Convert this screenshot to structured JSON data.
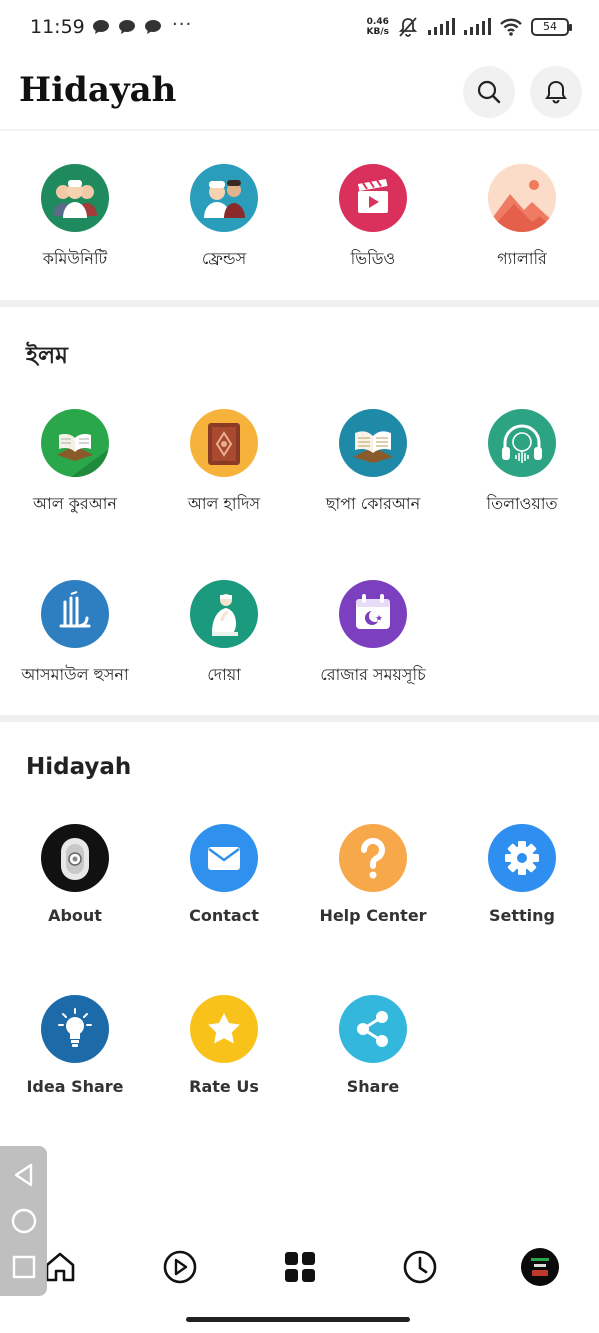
{
  "status_bar": {
    "time": "11:59",
    "dots": "···",
    "speed_value": "0.46",
    "speed_unit": "KB/s",
    "battery": "54"
  },
  "header": {
    "title": "Hidayah",
    "search_icon": "search-icon",
    "bell_icon": "bell-icon"
  },
  "top_grid": [
    {
      "label": "কমিউনিটি",
      "icon": "community-icon",
      "color": "#1f8a5e"
    },
    {
      "label": "ফ্রেন্ডস",
      "icon": "friends-icon",
      "color": "#2a9dbb"
    },
    {
      "label": "ভিডিও",
      "icon": "video-icon",
      "color": "#d9305c"
    },
    {
      "label": "গ্যালারি",
      "icon": "gallery-icon",
      "color": "#f5a388"
    }
  ],
  "ilm": {
    "title": "ইলম",
    "items": [
      {
        "label": "আল কুরআন",
        "icon": "quran-icon",
        "color": "#2aa74a"
      },
      {
        "label": "আল হাদিস",
        "icon": "hadith-icon",
        "color": "#f6b33c"
      },
      {
        "label": "ছাপা কোরআন",
        "icon": "printed-quran-icon",
        "color": "#1f8aa8"
      },
      {
        "label": "তিলাওয়াত",
        "icon": "tilawat-icon",
        "color": "#2ca382"
      },
      {
        "label": "আসমাউল হুসনা",
        "icon": "allah-icon",
        "color": "#2e7fc1"
      },
      {
        "label": "দোয়া",
        "icon": "dua-icon",
        "color": "#1b9a7d"
      },
      {
        "label": "রোজার সময়সূচি",
        "icon": "fasting-calendar-icon",
        "color": "#7b3fbf"
      }
    ]
  },
  "hidayah": {
    "title": "Hidayah",
    "items": [
      {
        "label": "About",
        "icon": "about-icon",
        "color": "#111111"
      },
      {
        "label": "Contact",
        "icon": "mail-icon",
        "color": "#2f90ee"
      },
      {
        "label": "Help Center",
        "icon": "help-icon",
        "color": "#f7a84b"
      },
      {
        "label": "Setting",
        "icon": "gear-icon",
        "color": "#2f8ff0"
      },
      {
        "label": "Idea Share",
        "icon": "lightbulb-icon",
        "color": "#1d6aa8"
      },
      {
        "label": "Rate Us",
        "icon": "star-icon",
        "color": "#f8c21b"
      },
      {
        "label": "Share",
        "icon": "share-icon",
        "color": "#33b7dc"
      }
    ]
  },
  "bottom_nav": [
    {
      "name": "home",
      "icon": "home-icon"
    },
    {
      "name": "videos",
      "icon": "play-icon"
    },
    {
      "name": "menu",
      "icon": "grid-icon"
    },
    {
      "name": "history",
      "icon": "clock-icon"
    },
    {
      "name": "profile",
      "icon": "avatar"
    }
  ],
  "float_nav": [
    "back-icon",
    "home-circle-icon",
    "recents-icon"
  ]
}
